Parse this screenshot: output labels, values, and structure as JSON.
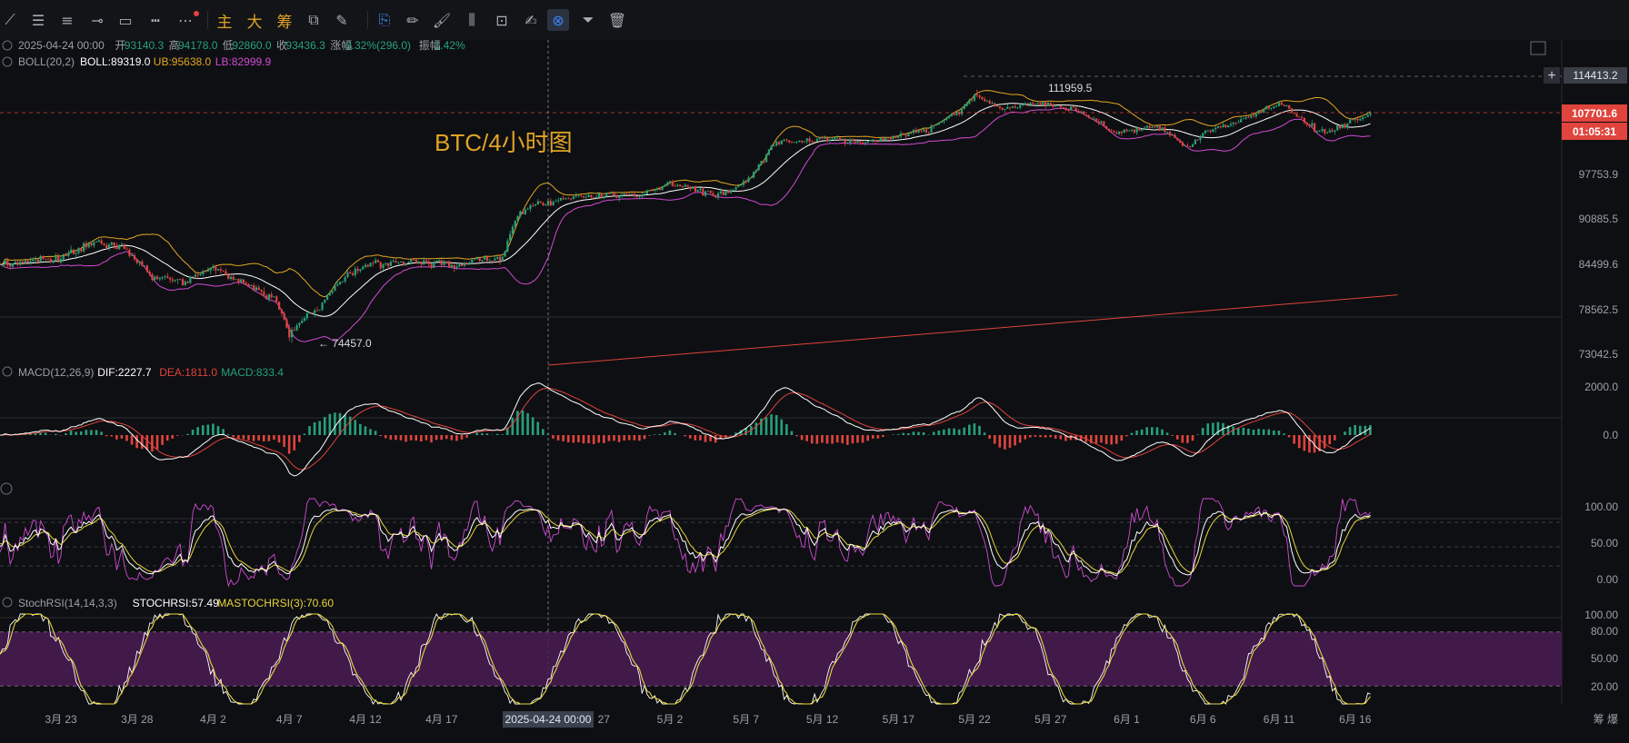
{
  "toolbar": {
    "items": [
      {
        "name": "trend-line-icon",
        "glyph": "⟋"
      },
      {
        "name": "parallel-channel-icon",
        "glyph": "☰"
      },
      {
        "name": "horizontal-lines-icon",
        "glyph": "≡"
      },
      {
        "name": "horizontal-ray-icon",
        "glyph": "⊸"
      },
      {
        "name": "rectangle-icon",
        "glyph": "▭"
      },
      {
        "name": "ruler-icon",
        "glyph": "┅"
      },
      {
        "name": "more-icon",
        "glyph": "⋯"
      },
      {
        "name": "main-chart-button",
        "glyph": "主"
      },
      {
        "name": "big-button",
        "glyph": "大"
      },
      {
        "name": "chips-button",
        "glyph": "筹"
      },
      {
        "name": "compare-icon",
        "glyph": "⧉"
      },
      {
        "name": "draw-tool-icon",
        "glyph": "✎"
      },
      {
        "name": "magnet-icon",
        "glyph": "⎘"
      },
      {
        "name": "pencil-icon",
        "glyph": "✏"
      },
      {
        "name": "brush-icon",
        "glyph": "🖌"
      },
      {
        "name": "bars-pattern-icon",
        "glyph": "⫼"
      },
      {
        "name": "lock-icon",
        "glyph": "⊡"
      },
      {
        "name": "edit-note-icon",
        "glyph": "✍"
      },
      {
        "name": "link-icon",
        "glyph": "⊗"
      },
      {
        "name": "filter-icon",
        "glyph": "⏷"
      },
      {
        "name": "trash-icon",
        "glyph": "🗑"
      }
    ]
  },
  "legend": {
    "date": "2025-04-24 00:00",
    "open_label": "开",
    "open": "93140.3",
    "high_label": "高",
    "high": "94178.0",
    "low_label": "低",
    "low": "92860.0",
    "close_label": "收",
    "close": "93436.3",
    "change_label": "涨幅",
    "change": "0.32%(296.0)",
    "amp_label": "振幅",
    "amp": "1.42%",
    "boll_name": "BOLL(20,2)",
    "boll": "BOLL:89319.0",
    "ub": "UB:95638.0",
    "lb": "LB:82999.9",
    "macd_name": "MACD(12,26,9)",
    "dif": "DIF:2227.7",
    "dea": "DEA:1811.0",
    "macd": "MACD:833.4",
    "stoch_name": "StochRSI(14,14,3,3)",
    "stochrsi": "STOCHRSI:57.49",
    "mastoch": "MASTOCHRSI(3):70.60"
  },
  "annotations": {
    "title": "BTC/4小时图",
    "high_mark": "111959.5",
    "low_mark": "← 74457.0"
  },
  "price_tags": {
    "top": "114413.2",
    "current": "107701.6",
    "countdown": "01:05:31"
  },
  "crosshair_date": "2025-04-24 00:00",
  "bottom_right": "筹 爆",
  "colors": {
    "bg": "#0e0f12",
    "up": "#26a17b",
    "down": "#e0443d",
    "boll_mid": "#ffffff",
    "boll_ub": "#e3a723",
    "boll_lb": "#d04bd4",
    "dea": "#e0443d",
    "dif": "#ffffff",
    "kdj_k": "#ffffff",
    "kdj_d": "#e8d53c",
    "kdj_j": "#d04bd4",
    "stoch": "#e8d53c",
    "stoch_band": "#4a1c55",
    "accent": "#e0a325"
  },
  "chart_data": {
    "type": "candlestick",
    "title": "BTC/4小时图",
    "price_axis": {
      "ticks": [
        "114413.2",
        "107701.6",
        "97753.9",
        "90885.5",
        "84499.6",
        "78562.5",
        "73042.5"
      ],
      "ylim": [
        73042.5,
        114413.2
      ]
    },
    "x_ticks": [
      "3月 23",
      "3月 28",
      "4月 2",
      "4月 7",
      "4月 12",
      "4月 17",
      "4月 27",
      "5月 2",
      "5月 7",
      "5月 12",
      "5月 17",
      "5月 22",
      "5月 27",
      "6月 1",
      "6月 6",
      "6月 11",
      "6月 16"
    ],
    "x_ticks_dates": [
      "2025-03-23",
      "2025-03-28",
      "2025-04-02",
      "2025-04-07",
      "2025-04-12",
      "2025-04-17",
      "2025-04-27",
      "2025-05-02",
      "2025-05-07",
      "2025-05-12",
      "2025-05-17",
      "2025-05-22",
      "2025-05-27",
      "2025-06-01",
      "2025-06-06",
      "2025-06-11",
      "2025-06-16"
    ],
    "x_start_date": "2025-03-19",
    "close_keypoints": [
      [
        "2025-03-19",
        84500
      ],
      [
        "2025-03-23",
        85500
      ],
      [
        "2025-03-25",
        87500
      ],
      [
        "2025-03-27",
        87000
      ],
      [
        "2025-03-29",
        83000
      ],
      [
        "2025-03-31",
        82300
      ],
      [
        "2025-04-02",
        84000
      ],
      [
        "2025-04-03",
        83000
      ],
      [
        "2025-04-06",
        80000
      ],
      [
        "2025-04-07",
        75500
      ],
      [
        "2025-04-08",
        77500
      ],
      [
        "2025-04-09",
        79000
      ],
      [
        "2025-04-10",
        81500
      ],
      [
        "2025-04-12",
        84500
      ],
      [
        "2025-04-15",
        84800
      ],
      [
        "2025-04-18",
        84500
      ],
      [
        "2025-04-21",
        85500
      ],
      [
        "2025-04-22",
        91500
      ],
      [
        "2025-04-23",
        93000
      ],
      [
        "2025-04-24",
        93400
      ],
      [
        "2025-04-26",
        94500
      ],
      [
        "2025-04-30",
        94500
      ],
      [
        "2025-05-02",
        96500
      ],
      [
        "2025-05-05",
        94500
      ],
      [
        "2025-05-07",
        96500
      ],
      [
        "2025-05-08",
        99500
      ],
      [
        "2025-05-09",
        103000
      ],
      [
        "2025-05-12",
        103500
      ],
      [
        "2025-05-15",
        103000
      ],
      [
        "2025-05-19",
        105000
      ],
      [
        "2025-05-21",
        108000
      ],
      [
        "2025-05-22",
        111000
      ],
      [
        "2025-05-24",
        108500
      ],
      [
        "2025-05-26",
        109500
      ],
      [
        "2025-05-29",
        108000
      ],
      [
        "2025-05-31",
        104500
      ],
      [
        "2025-06-03",
        105500
      ],
      [
        "2025-06-05",
        102000
      ],
      [
        "2025-06-06",
        104500
      ],
      [
        "2025-06-09",
        107000
      ],
      [
        "2025-06-11",
        109500
      ],
      [
        "2025-06-13",
        105500
      ],
      [
        "2025-06-14",
        104500
      ],
      [
        "2025-06-16",
        106500
      ],
      [
        "2025-06-17",
        107700
      ]
    ],
    "trendline": [
      [
        "2025-04-24",
        73042.5
      ],
      [
        "2025-06-17",
        80500
      ]
    ],
    "macd_axis": {
      "ticks": [
        "2000.0",
        "0.0"
      ]
    },
    "kdj_axis": {
      "ticks": [
        "100.00",
        "50.00",
        "0.00"
      ]
    },
    "stochrsi_axis": {
      "ticks": [
        "100.00",
        "80.00",
        "50.00",
        "20.00"
      ]
    }
  }
}
